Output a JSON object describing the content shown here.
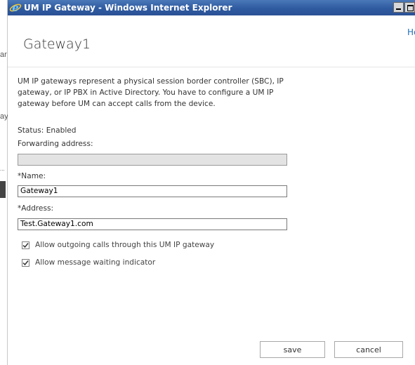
{
  "window": {
    "title": "UM IP Gateway - Windows Internet Explorer"
  },
  "header": {
    "help_link": "He",
    "page_title": "Gateway1"
  },
  "background_fragments": [
    "ar",
    "ay",
    "..."
  ],
  "description": "UM IP gateways represent a physical session border controller (SBC), IP gateway, or IP PBX in Active Directory. You have to configure a UM IP gateway before UM can accept calls from the device.",
  "status": {
    "text": "Status: Enabled"
  },
  "forwarding": {
    "label": "Forwarding address:",
    "value": ""
  },
  "name": {
    "label": "*Name:",
    "value": "Gateway1"
  },
  "address": {
    "label": "*Address:",
    "value": "Test.Gateway1.com"
  },
  "options": [
    {
      "label": "Allow outgoing calls through this UM IP gateway",
      "checked": true
    },
    {
      "label": "Allow message waiting indicator",
      "checked": true
    }
  ],
  "buttons": {
    "save": "save",
    "cancel": "cancel"
  },
  "colors": {
    "titlebar": "#2f5aa0",
    "link": "#1e6fb8",
    "disabled_field": "#e3e3e3"
  },
  "icons": {
    "browser": "internet-explorer-icon",
    "minimize": "minimize-icon",
    "maximize": "maximize-icon",
    "checkmark": "checkmark-icon"
  }
}
